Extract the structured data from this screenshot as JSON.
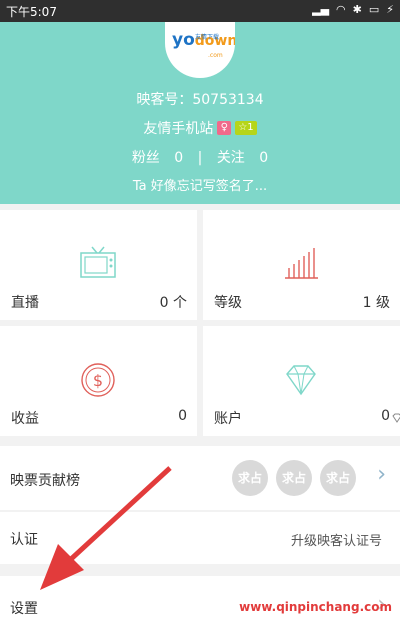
{
  "status": {
    "time": "下午5:07",
    "battery": "⚡"
  },
  "profile": {
    "logo_text_y": "yo",
    "logo_text_down": "down",
    "logo_sub": "友情下载",
    "logo_com": ".com",
    "uid_label": "映客号：50753134",
    "name": "友情手机站",
    "gender_symbol": "♀",
    "level": "☆1",
    "fans_label": "粉丝",
    "fans_count": "0",
    "follow_label": "关注",
    "follow_count": "0",
    "signature": "Ta 好像忘记写签名了..."
  },
  "grid": [
    {
      "label": "直播",
      "value": "0 个",
      "icon": "tv-icon"
    },
    {
      "label": "等级",
      "value": "1 级",
      "icon": "level-bars-icon"
    },
    {
      "label": "收益",
      "value": "0",
      "icon": "dollar-coin-icon"
    },
    {
      "label": "账户",
      "value": "0",
      "icon": "diamond-icon"
    }
  ],
  "rows": {
    "contrib_label": "映票贡献榜",
    "chip_label": "求占",
    "verify_label": "认证",
    "verify_value": "升级映客认证号",
    "settings_label": "设置"
  },
  "watermark": "www.qinpinchang.com",
  "colors": {
    "header": "#7fd7c9",
    "accent_red": "#e23b3b"
  }
}
